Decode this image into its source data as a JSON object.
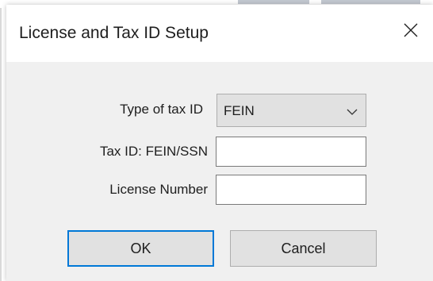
{
  "dialog": {
    "title": "License and Tax ID Setup",
    "close_icon": "close-icon"
  },
  "form": {
    "tax_id_type": {
      "label": "Type of tax ID",
      "selected": "FEIN",
      "icon": "chevron-down-icon"
    },
    "tax_id": {
      "label": "Tax ID: FEIN/SSN",
      "value": ""
    },
    "license_number": {
      "label": "License Number",
      "value": ""
    }
  },
  "buttons": {
    "ok_label": "OK",
    "cancel_label": "Cancel"
  },
  "colors": {
    "accent": "#0078d7",
    "dialog_body": "#f0f0f0",
    "button_face": "#e1e1e1"
  }
}
